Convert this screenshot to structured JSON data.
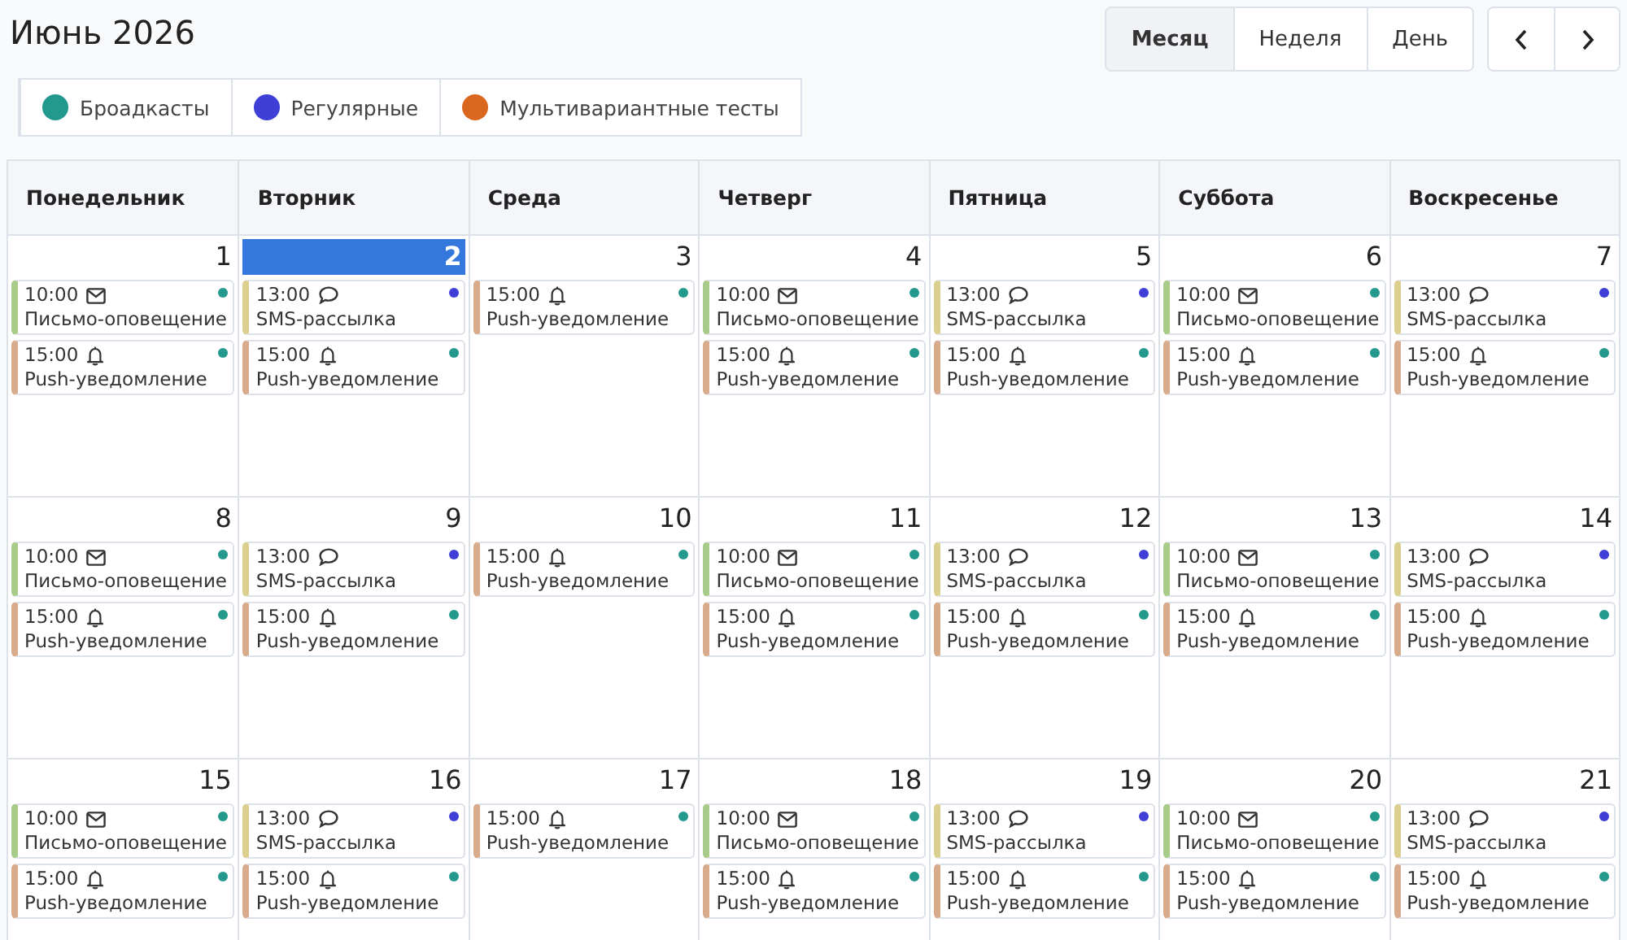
{
  "title": "Июнь 2026",
  "views": [
    {
      "label": "Месяц",
      "selected": true
    },
    {
      "label": "Неделя",
      "selected": false
    },
    {
      "label": "День",
      "selected": false
    }
  ],
  "legend": [
    {
      "label": "Броадкасты",
      "color": "#23998e"
    },
    {
      "label": "Регулярные",
      "color": "#3f3fd8"
    },
    {
      "label": "Мультивариантные тесты",
      "color": "#d9681e"
    }
  ],
  "weekdays": [
    "Понедельник",
    "Вторник",
    "Среда",
    "Четверг",
    "Пятница",
    "Суббота",
    "Воскресенье"
  ],
  "weeks": [
    {
      "days": [
        {
          "day": "1",
          "selected": false,
          "events": [
            {
              "kind": "email",
              "time": "10:00",
              "title": "Письмо-оповещение",
              "color": "#23998e"
            },
            {
              "kind": "push",
              "time": "15:00",
              "title": "Push-уведомление",
              "color": "#23998e"
            }
          ]
        },
        {
          "day": "2",
          "selected": true,
          "events": [
            {
              "kind": "sms",
              "time": "13:00",
              "title": "SMS-рассылка",
              "color": "#3f3fd8"
            },
            {
              "kind": "push",
              "time": "15:00",
              "title": "Push-уведомление",
              "color": "#23998e"
            }
          ]
        },
        {
          "day": "3",
          "selected": false,
          "events": [
            {
              "kind": "push",
              "time": "15:00",
              "title": "Push-уведомление",
              "color": "#23998e"
            }
          ]
        },
        {
          "day": "4",
          "selected": false,
          "events": [
            {
              "kind": "email",
              "time": "10:00",
              "title": "Письмо-оповещение",
              "color": "#23998e"
            },
            {
              "kind": "push",
              "time": "15:00",
              "title": "Push-уведомление",
              "color": "#23998e"
            }
          ]
        },
        {
          "day": "5",
          "selected": false,
          "events": [
            {
              "kind": "sms",
              "time": "13:00",
              "title": "SMS-рассылка",
              "color": "#3f3fd8"
            },
            {
              "kind": "push",
              "time": "15:00",
              "title": "Push-уведомление",
              "color": "#23998e"
            }
          ]
        },
        {
          "day": "6",
          "selected": false,
          "events": [
            {
              "kind": "email",
              "time": "10:00",
              "title": "Письмо-оповещение",
              "color": "#23998e"
            },
            {
              "kind": "push",
              "time": "15:00",
              "title": "Push-уведомление",
              "color": "#23998e"
            }
          ]
        },
        {
          "day": "7",
          "selected": false,
          "events": [
            {
              "kind": "sms",
              "time": "13:00",
              "title": "SMS-рассылка",
              "color": "#3f3fd8"
            },
            {
              "kind": "push",
              "time": "15:00",
              "title": "Push-уведомление",
              "color": "#23998e"
            }
          ]
        }
      ]
    },
    {
      "days": [
        {
          "day": "8",
          "selected": false,
          "events": [
            {
              "kind": "email",
              "time": "10:00",
              "title": "Письмо-оповещение",
              "color": "#23998e"
            },
            {
              "kind": "push",
              "time": "15:00",
              "title": "Push-уведомление",
              "color": "#23998e"
            }
          ]
        },
        {
          "day": "9",
          "selected": false,
          "events": [
            {
              "kind": "sms",
              "time": "13:00",
              "title": "SMS-рассылка",
              "color": "#3f3fd8"
            },
            {
              "kind": "push",
              "time": "15:00",
              "title": "Push-уведомление",
              "color": "#23998e"
            }
          ]
        },
        {
          "day": "10",
          "selected": false,
          "events": [
            {
              "kind": "push",
              "time": "15:00",
              "title": "Push-уведомление",
              "color": "#23998e"
            }
          ]
        },
        {
          "day": "11",
          "selected": false,
          "events": [
            {
              "kind": "email",
              "time": "10:00",
              "title": "Письмо-оповещение",
              "color": "#23998e"
            },
            {
              "kind": "push",
              "time": "15:00",
              "title": "Push-уведомление",
              "color": "#23998e"
            }
          ]
        },
        {
          "day": "12",
          "selected": false,
          "events": [
            {
              "kind": "sms",
              "time": "13:00",
              "title": "SMS-рассылка",
              "color": "#3f3fd8"
            },
            {
              "kind": "push",
              "time": "15:00",
              "title": "Push-уведомление",
              "color": "#23998e"
            }
          ]
        },
        {
          "day": "13",
          "selected": false,
          "events": [
            {
              "kind": "email",
              "time": "10:00",
              "title": "Письмо-оповещение",
              "color": "#23998e"
            },
            {
              "kind": "push",
              "time": "15:00",
              "title": "Push-уведомление",
              "color": "#23998e"
            }
          ]
        },
        {
          "day": "14",
          "selected": false,
          "events": [
            {
              "kind": "sms",
              "time": "13:00",
              "title": "SMS-рассылка",
              "color": "#3f3fd8"
            },
            {
              "kind": "push",
              "time": "15:00",
              "title": "Push-уведомление",
              "color": "#23998e"
            }
          ]
        }
      ]
    },
    {
      "days": [
        {
          "day": "15",
          "selected": false,
          "events": [
            {
              "kind": "email",
              "time": "10:00",
              "title": "Письмо-оповещение",
              "color": "#23998e"
            },
            {
              "kind": "push",
              "time": "15:00",
              "title": "Push-уведомление",
              "color": "#23998e"
            }
          ]
        },
        {
          "day": "16",
          "selected": false,
          "events": [
            {
              "kind": "sms",
              "time": "13:00",
              "title": "SMS-рассылка",
              "color": "#3f3fd8"
            },
            {
              "kind": "push",
              "time": "15:00",
              "title": "Push-уведомление",
              "color": "#23998e"
            }
          ]
        },
        {
          "day": "17",
          "selected": false,
          "events": [
            {
              "kind": "push",
              "time": "15:00",
              "title": "Push-уведомление",
              "color": "#23998e"
            }
          ]
        },
        {
          "day": "18",
          "selected": false,
          "events": [
            {
              "kind": "email",
              "time": "10:00",
              "title": "Письмо-оповещение",
              "color": "#23998e"
            },
            {
              "kind": "push",
              "time": "15:00",
              "title": "Push-уведомление",
              "color": "#23998e"
            }
          ]
        },
        {
          "day": "19",
          "selected": false,
          "events": [
            {
              "kind": "sms",
              "time": "13:00",
              "title": "SMS-рассылка",
              "color": "#3f3fd8"
            },
            {
              "kind": "push",
              "time": "15:00",
              "title": "Push-уведомление",
              "color": "#23998e"
            }
          ]
        },
        {
          "day": "20",
          "selected": false,
          "events": [
            {
              "kind": "email",
              "time": "10:00",
              "title": "Письмо-оповещение",
              "color": "#23998e"
            },
            {
              "kind": "push",
              "time": "15:00",
              "title": "Push-уведомление",
              "color": "#23998e"
            }
          ]
        },
        {
          "day": "21",
          "selected": false,
          "events": [
            {
              "kind": "sms",
              "time": "13:00",
              "title": "SMS-рассылка",
              "color": "#3f3fd8"
            },
            {
              "kind": "push",
              "time": "15:00",
              "title": "Push-уведомление",
              "color": "#23998e"
            }
          ]
        }
      ]
    }
  ]
}
